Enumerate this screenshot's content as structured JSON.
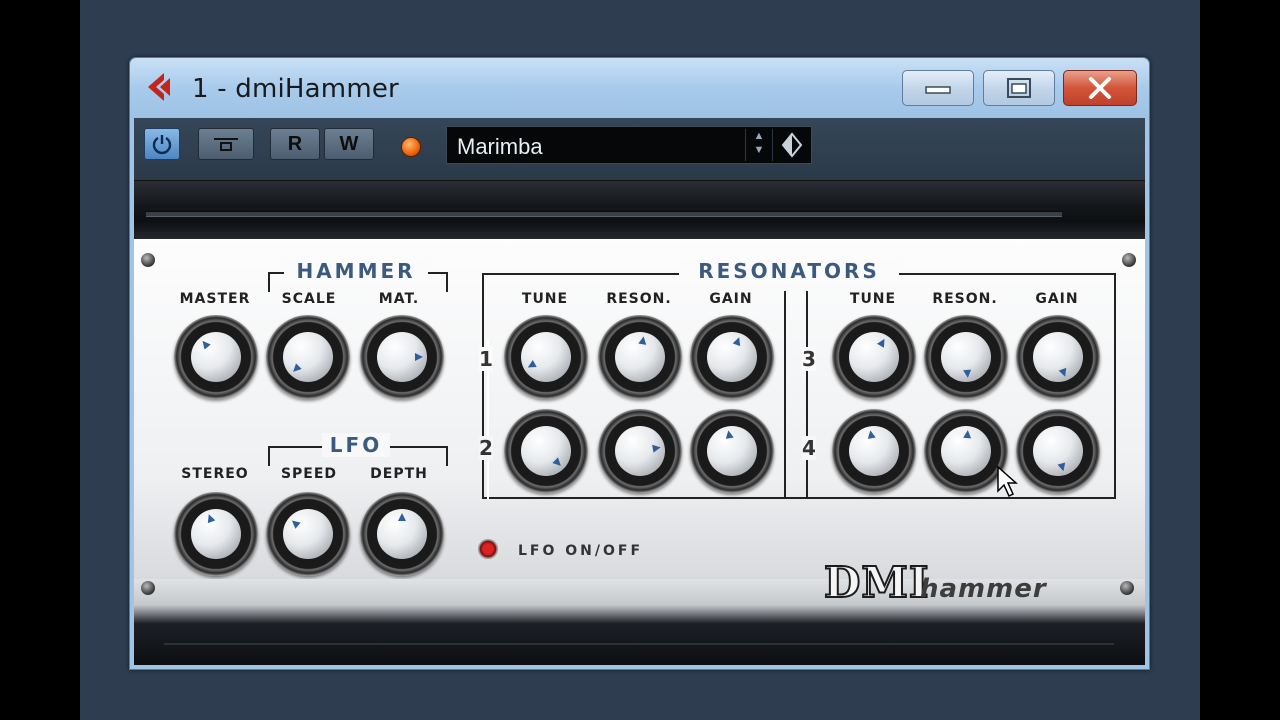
{
  "window": {
    "title": "1 - dmiHammer"
  },
  "toolbar": {
    "read_label": "R",
    "write_label": "W",
    "preset_name": "Marimba"
  },
  "hammer": {
    "title": "HAMMER",
    "master_label": "MASTER",
    "scale_label": "SCALE",
    "mat_label": "MAT."
  },
  "lfo": {
    "title": "LFO",
    "stereo_label": "STEREO",
    "speed_label": "SPEED",
    "depth_label": "DEPTH",
    "onoff_label": "LFO ON/OFF"
  },
  "resonators": {
    "title": "RESONATORS",
    "tune_label": "TUNE",
    "reson_label": "RESON.",
    "gain_label": "GAIN",
    "rows": [
      "1",
      "2",
      "3",
      "4"
    ]
  },
  "brand": {
    "logo": "DMI",
    "name": "hammer"
  },
  "colors": {
    "accent": "#3b5a80",
    "led": "#f06a10",
    "close": "#d2553a"
  },
  "icons": [
    "app-logo-icon",
    "minimize-icon",
    "maximize-icon",
    "close-icon",
    "power-icon",
    "bypass-icon",
    "preset-menu-icon",
    "cursor-icon"
  ]
}
